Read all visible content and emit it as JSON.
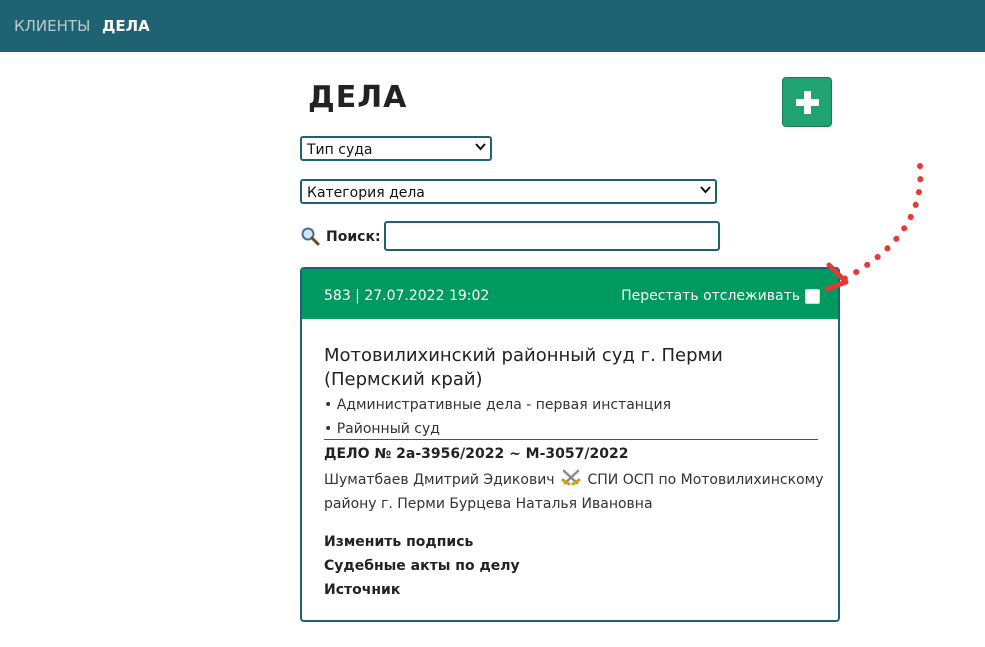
{
  "nav": {
    "clients_label": "КЛИЕНТЫ",
    "cases_label": "ДЕЛА"
  },
  "page": {
    "title": "ДЕЛА",
    "add_icon": "plus-icon"
  },
  "filters": {
    "court_type": {
      "selected": "Тип суда"
    },
    "case_category": {
      "selected": "Категория дела"
    },
    "search": {
      "label": "Поиск:",
      "value": "",
      "icon": "magnifier-icon"
    }
  },
  "case_card": {
    "meta": "583 | 27.07.2022 19:02",
    "untrack_label": "Перестать отслеживать",
    "untrack_checked": false,
    "court_name": "Мотовилихинский районный суд г. Перми (Пермский край)",
    "bullets": [
      "• Административные дела - первая инстанция",
      "• Районный суд"
    ],
    "case_number": "ДЕЛО № 2а-3956/2022 ~ М-3057/2022",
    "plaintiff": "Шуматбаев Дмитрий Эдикович",
    "defendant": "СПИ ОСП по Мотовилихинскому району г. Перми Бурцева Наталья Ивановна",
    "versus_icon": "crossed-swords-icon",
    "links": {
      "edit_signature": "Изменить подпись",
      "court_acts": "Судебные акты по делу",
      "source": "Источник"
    }
  },
  "colors": {
    "topbar": "#1f6372",
    "card_header": "#009960",
    "add_button": "#21a273",
    "annotation_arrow": "#e53935"
  }
}
